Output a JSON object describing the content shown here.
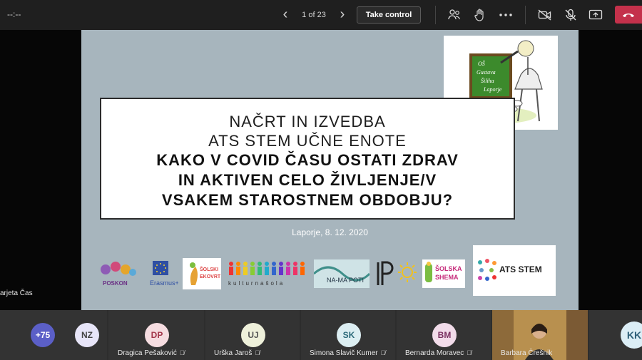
{
  "topbar": {
    "timer": "--:--",
    "page_indicator": "1 of 23",
    "take_control_label": "Take control"
  },
  "slide": {
    "title_line1": "NAČRT IN IZVEDBA",
    "title_line2": "ATS STEM UČNE ENOTE",
    "title_bold1": "KAKO V COVID ČASU OSTATI ZDRAV",
    "title_bold2": "IN AKTIVEN CELO ŽIVLJENJE/V",
    "title_bold3": "VSAKEM STAROSTNEM OBDOBJU?",
    "date": "Laporje, 8. 12. 2020",
    "school_logo": {
      "line1": "OŠ",
      "line2": "Gustava",
      "line3": "Šiliha",
      "line4": "Laporje"
    },
    "logos": {
      "poskon": "POSKON",
      "erasmus": "Erasmus+",
      "ekovrt": "ŠOLSKI EKOVRT",
      "kulturna": "kulturnašola",
      "namapoti": "NA-MA POTI",
      "shema": "ŠOLSKA SHEMA",
      "ats": "ATS STEM"
    }
  },
  "speaker_label": "arjeta Čas",
  "participants": [
    {
      "initials": "+75",
      "name": "",
      "bg": "#5b5fc7",
      "fg": "#ffffff"
    },
    {
      "initials": "NZ",
      "name": "",
      "bg": "#e7e5f8",
      "fg": "#444"
    },
    {
      "initials": "DP",
      "name": "Dragica Pešaković",
      "bg": "#f6dde1",
      "fg": "#a3364a"
    },
    {
      "initials": "UJ",
      "name": "Urška Jaroš",
      "bg": "#eef0da",
      "fg": "#555"
    },
    {
      "initials": "SK",
      "name": "Simona Slavič Kumer",
      "bg": "#dceef2",
      "fg": "#2c6a7a"
    },
    {
      "initials": "BM",
      "name": "Bernarda Moravec",
      "bg": "#f2dcea",
      "fg": "#7b3162"
    },
    {
      "initials": "",
      "name": "Barbara Črešnik",
      "bg": "#b88a4c",
      "fg": "#fff"
    },
    {
      "initials": "KK",
      "name": "",
      "bg": "#dceef6",
      "fg": "#2e5f78"
    }
  ],
  "colors": {
    "hangup": "#c4314b",
    "slide_bg": "#a7b5bd"
  },
  "icons": [
    "people-icon",
    "raise-hand-icon",
    "more-icon",
    "camera-off-icon",
    "mic-off-icon",
    "share-icon",
    "hangup-icon"
  ]
}
